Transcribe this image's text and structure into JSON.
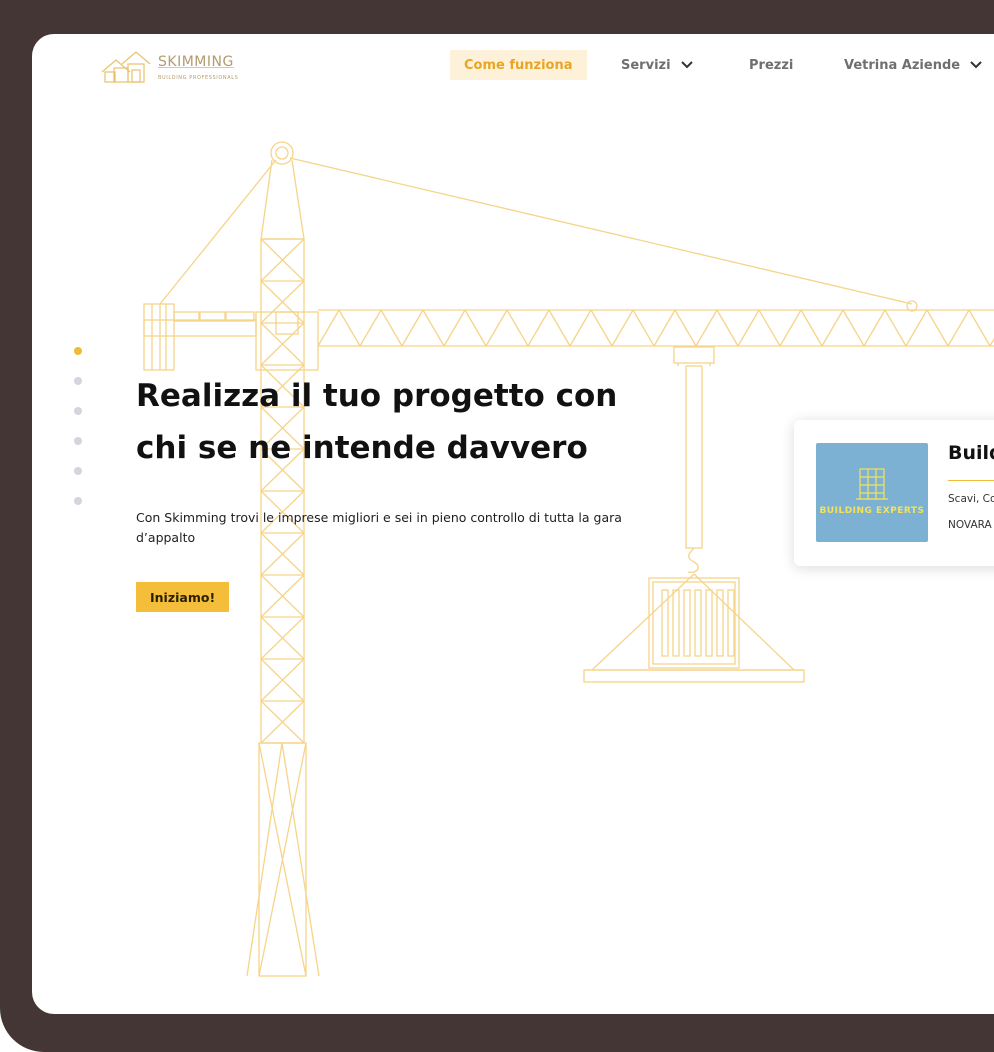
{
  "brand": {
    "name": "SKIMMING",
    "tagline": "BUILDING PROFESSIONALS"
  },
  "nav": {
    "items": [
      {
        "label": "Come funziona",
        "active": true
      },
      {
        "label": "Servizi",
        "dropdown": true
      },
      {
        "label": "Prezzi"
      },
      {
        "label": "Vetrina Aziende",
        "dropdown": true
      }
    ]
  },
  "slider": {
    "count": 6,
    "active_index": 0
  },
  "hero": {
    "title_line1": "Realizza il tuo progetto con",
    "title_line2": "chi se ne intende davvero",
    "subtitle": "Con Skimming trovi le imprese migliori e sei in pieno controllo di tutta la gara d’appalto",
    "cta": "Iniziamo!"
  },
  "card": {
    "logo_text": "BUILDING EXPERTS",
    "name": "Build",
    "services": "Scavi, Co",
    "city": "NOVARA"
  },
  "colors": {
    "accent": "#f4bd3a",
    "nav_active_bg": "#fdf2d9",
    "nav_active_text": "#e8a524",
    "crane_line": "#f6d489",
    "frame": "#433635",
    "card_logo_bg": "#7cb1d4"
  },
  "icons": {
    "nav_dropdown": "chevron-down-icon",
    "logo": "house-outline-logo"
  }
}
